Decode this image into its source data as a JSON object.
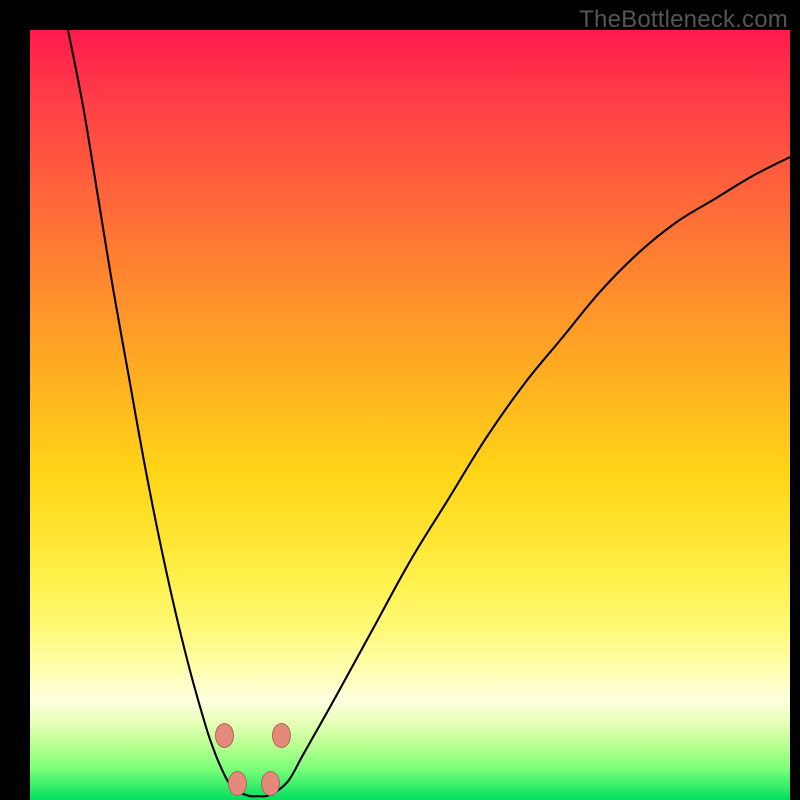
{
  "watermark": "TheBottleneck.com",
  "chart_data": {
    "type": "line",
    "title": "",
    "xlabel": "",
    "ylabel": "",
    "xlim": [
      0,
      100
    ],
    "ylim": [
      0,
      100
    ],
    "grid": false,
    "legend": false,
    "series": [
      {
        "name": "left-branch",
        "x": [
          5,
          7,
          9,
          11,
          13,
          15,
          17,
          19,
          21,
          23,
          24,
          25,
          26,
          27,
          28
        ],
        "values": [
          100,
          90,
          78,
          66,
          55,
          44,
          34,
          25,
          17,
          10,
          7,
          4.5,
          2.5,
          1.2,
          0.8
        ]
      },
      {
        "name": "right-branch",
        "x": [
          32,
          34,
          36,
          40,
          45,
          50,
          55,
          60,
          65,
          70,
          75,
          80,
          85,
          90,
          95,
          100
        ],
        "values": [
          0.8,
          2.5,
          6,
          13,
          22,
          31,
          39,
          47,
          54,
          60,
          66,
          71,
          75,
          78,
          81,
          83.5
        ]
      },
      {
        "name": "valley-floor",
        "x": [
          28,
          29,
          30,
          31,
          32
        ],
        "values": [
          0.8,
          0.5,
          0.5,
          0.5,
          0.8
        ]
      }
    ],
    "markers": [
      {
        "name": "left-upper-marker",
        "x": 25.5,
        "y": 8.5
      },
      {
        "name": "right-upper-marker",
        "x": 33.0,
        "y": 8.5
      },
      {
        "name": "left-lower-marker",
        "x": 27.2,
        "y": 2.3
      },
      {
        "name": "right-lower-marker",
        "x": 31.5,
        "y": 2.3
      }
    ],
    "curve_stroke": "#000000",
    "curve_stroke_width": 2.1,
    "marker_fill": "#e58a7a"
  }
}
